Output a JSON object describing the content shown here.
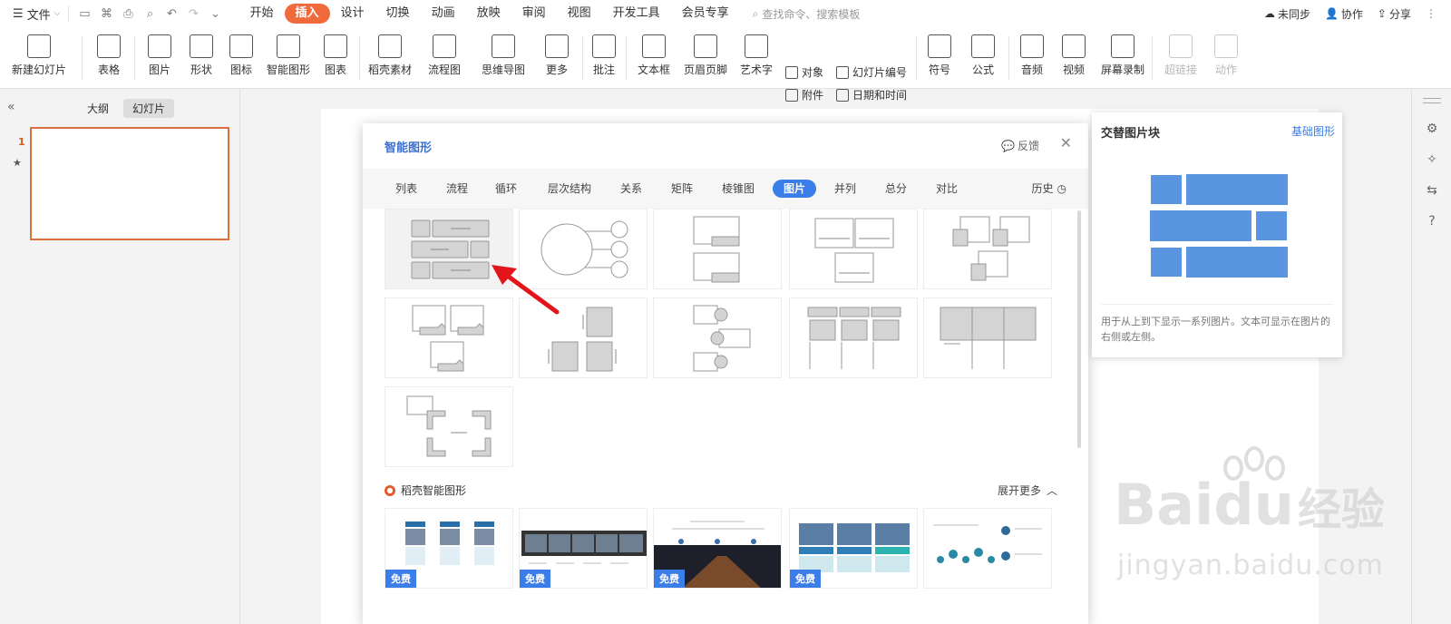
{
  "topbar": {
    "file_label": "文件",
    "tabs": [
      "开始",
      "插入",
      "设计",
      "切换",
      "动画",
      "放映",
      "审阅",
      "视图",
      "开发工具",
      "会员专享"
    ],
    "active_tab": "插入",
    "search_placeholder": "查找命令、搜索模板",
    "sync_label": "未同步",
    "collab_label": "协作",
    "share_label": "分享"
  },
  "ribbon": {
    "new_slide": "新建幻灯片",
    "table": "表格",
    "picture": "图片",
    "shape": "形状",
    "icon": "图标",
    "smart_art": "智能图形",
    "chart": "图表",
    "docer_assets": "稻壳素材",
    "flowchart": "流程图",
    "mindmap": "思维导图",
    "more": "更多",
    "comment": "批注",
    "textbox": "文本框",
    "header_footer": "页眉页脚",
    "wordart": "艺术字",
    "object": "对象",
    "slide_number": "幻灯片编号",
    "attachment": "附件",
    "datetime": "日期和时间",
    "symbol": "符号",
    "formula": "公式",
    "audio": "音频",
    "video": "视频",
    "screen_record": "屏幕录制",
    "hyperlink": "超链接",
    "action": "动作"
  },
  "leftpane": {
    "outline_tab": "大纲",
    "slides_tab": "幻灯片",
    "slide_number": "1"
  },
  "dialog": {
    "title": "智能图形",
    "feedback": "反馈",
    "categories": [
      "列表",
      "流程",
      "循环",
      "层次结构",
      "关系",
      "矩阵",
      "棱锥图",
      "图片",
      "并列",
      "总分",
      "对比"
    ],
    "active_category": "图片",
    "history": "历史",
    "smart_section_title": "稻壳智能图形",
    "expand_more": "展开更多",
    "free_badge": "免费"
  },
  "preview": {
    "title": "交替图片块",
    "link": "基础图形",
    "description": "用于从上到下显示一系列图片。文本可显示在图片的右侧或左侧。"
  },
  "watermark": {
    "brand": "Bai",
    "brand2": "du",
    "cn": "经验",
    "url": "jingyan.baidu.com"
  },
  "colors": {
    "accent": "#f06a3c",
    "primary_blue": "#3b7de9",
    "selection_border": "#d9713c",
    "preview_block": "#5a95e2",
    "arrow_red": "#e3151a"
  }
}
